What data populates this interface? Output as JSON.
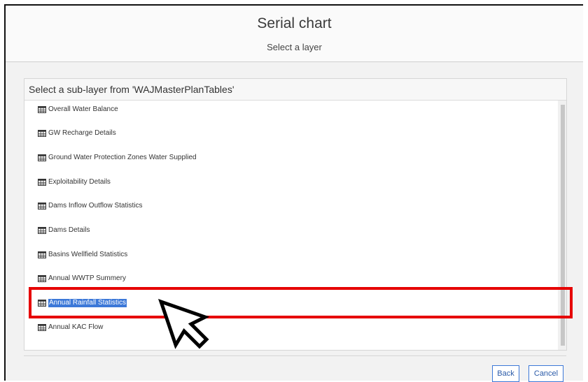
{
  "dialog": {
    "title": "Serial chart",
    "subtitle": "Select a layer"
  },
  "panel": {
    "title": "Select a sub-layer from 'WAJMasterPlanTables'"
  },
  "layers": [
    {
      "label": "Overall Water Balance",
      "icon": "table-icon",
      "selected": false
    },
    {
      "label": "GW Recharge Details",
      "icon": "table-icon",
      "selected": false
    },
    {
      "label": "Ground Water Protection Zones Water Supplied",
      "icon": "table-icon",
      "selected": false
    },
    {
      "label": "Exploitability Details",
      "icon": "table-icon",
      "selected": false
    },
    {
      "label": "Dams Inflow Outflow Statistics",
      "icon": "table-icon",
      "selected": false
    },
    {
      "label": "Dams Details",
      "icon": "table-icon",
      "selected": false
    },
    {
      "label": "Basins Wellfield Statistics",
      "icon": "table-icon",
      "selected": false
    },
    {
      "label": "Annual WWTP Summery",
      "icon": "table-icon",
      "selected": false
    },
    {
      "label": "Annual Rainfall Statistics",
      "icon": "table-icon",
      "selected": true
    },
    {
      "label": "Annual KAC Flow",
      "icon": "table-icon",
      "selected": false
    }
  ],
  "buttons": {
    "back": "Back",
    "cancel": "Cancel"
  },
  "colors": {
    "highlight_box": "#e60000",
    "selection": "#3c78d8",
    "button_border": "#3c78d8"
  },
  "overlay": {
    "cursor_icon": "mouse-pointer-icon"
  }
}
